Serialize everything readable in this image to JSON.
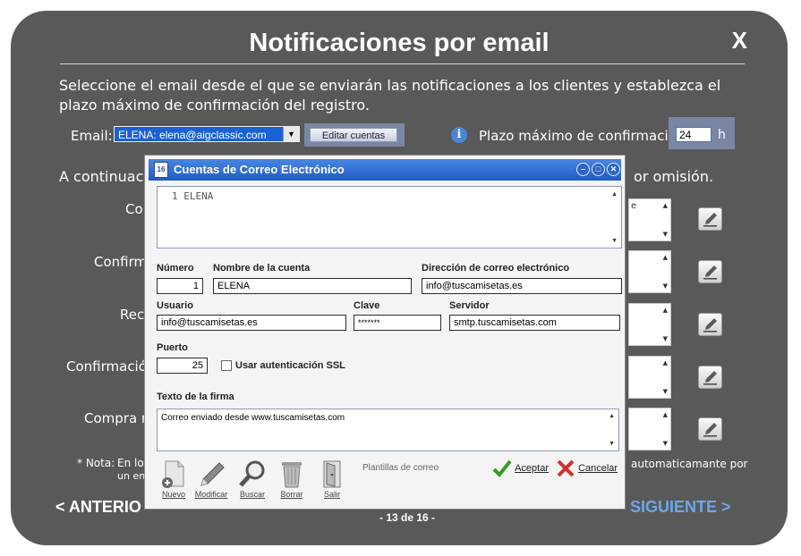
{
  "panel": {
    "title": "Notificaciones por email",
    "close": "X",
    "intro": "Seleccione el email desde el que se enviarán las notificaciones a los clientes y establezca el plazo máximo de confirmación del registro.",
    "email_label": "Email:",
    "email_value": "ELENA: elena@aigclassic.com",
    "edit_accounts": "Editar cuentas",
    "plazo_label": "Plazo máximo de confirmación",
    "plazo_value": "24",
    "plazo_unit": "h",
    "continuation_left": "A continuaci",
    "continuation_right": "or omisión.",
    "rows": [
      {
        "label": "Co",
        "fragment": "e"
      },
      {
        "label": "Confirm",
        "fragment": ""
      },
      {
        "label": "Rec",
        "fragment": ""
      },
      {
        "label": "Confirmació",
        "fragment": ""
      },
      {
        "label": "Compra r",
        "fragment": ""
      }
    ],
    "note_star": "* Nota:",
    "note_left1": "En los",
    "note_left2": "un en",
    "note_right": "automaticamante por",
    "prev": "< ANTERIO",
    "next": "SIGUIENTE >",
    "page": "- 13 de 16 -"
  },
  "dialog": {
    "title": "Cuentas de Correo Electrónico",
    "icon_glyph": "16",
    "list_items": [
      "1 ELENA"
    ],
    "labels": {
      "numero": "Número",
      "nombre": "Nombre de la cuenta",
      "direccion": "Dirección de correo electrónico",
      "usuario": "Usuario",
      "clave": "Clave",
      "servidor": "Servidor",
      "puerto": "Puerto",
      "ssl": "Usar autenticación SSL",
      "firma": "Texto de la firma"
    },
    "values": {
      "numero": "1",
      "nombre": "ELENA",
      "direccion": "info@tuscamisetas.es",
      "usuario": "info@tuscamisetas.es",
      "clave": "*******",
      "servidor": "smtp.tuscamisetas.com",
      "puerto": "25",
      "firma": "Correo enviado desde www.tuscamisetas.com"
    },
    "ssl_checked": false,
    "toolbar": [
      "Nuevo",
      "Modificar",
      "Buscar",
      "Borrar",
      "Salir"
    ],
    "templates": "Plantillas de correo",
    "accept": "Aceptar",
    "cancel": "Cancelar"
  },
  "colors": {
    "panel": "#595959",
    "dialog_title": "#2d6bd6",
    "next_link": "#6ea6e8"
  }
}
